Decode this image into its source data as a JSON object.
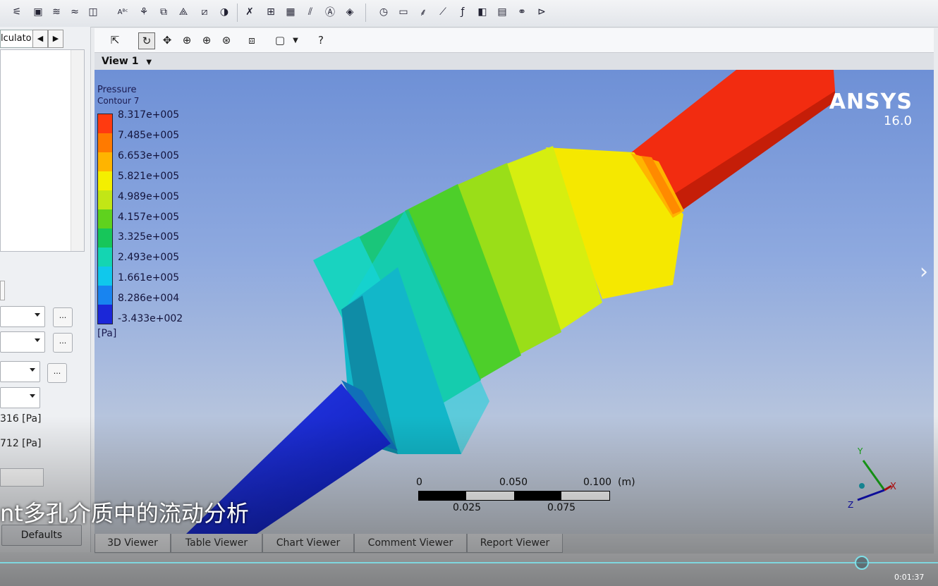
{
  "toolbar": {
    "icons": [
      "workflow-icon",
      "location-icon",
      "vector-icon",
      "streamline-icon",
      "volume-icon",
      "text-icon",
      "probe-icon",
      "coordinate-frame-icon",
      "symmetry-icon",
      "clip-plane-icon",
      "color-map-icon",
      "variable-icon",
      "table-icon",
      "chart-icon",
      "comment-icon",
      "figure-icon",
      "timestep-icon",
      "animation-icon",
      "quick-edit-icon",
      "pointer-icon",
      "function-icon",
      "report-icon",
      "export-icon",
      "mesh-icon",
      "command-icon"
    ]
  },
  "left_panel": {
    "calculator_tab": "lculato",
    "prev_arrow": "◀",
    "next_arrow": "▶",
    "value_1": "316 [Pa]",
    "value_2": "712 [Pa]",
    "dots": "...",
    "defaults_button": "Defaults"
  },
  "viewer": {
    "view_title": "View 1",
    "tool_icons": [
      "select-icon",
      "rotate-icon",
      "pan-icon",
      "zoom-icon",
      "zoom-box-icon",
      "fit-view-icon",
      "orthographic-icon",
      "viewport-layout-icon",
      "help-icon"
    ]
  },
  "legend": {
    "variable": "Pressure",
    "name": "Contour 7",
    "unit": "[Pa]",
    "values": [
      "8.317e+005",
      "7.485e+005",
      "6.653e+005",
      "5.821e+005",
      "4.989e+005",
      "4.157e+005",
      "3.325e+005",
      "2.493e+005",
      "1.661e+005",
      "8.286e+004",
      "-3.433e+002"
    ],
    "colors": [
      "#ff3a10",
      "#ff7a00",
      "#ffb400",
      "#f4ef00",
      "#c2e616",
      "#5fd21e",
      "#17c65a",
      "#14d5b2",
      "#10c8ec",
      "#1884f0",
      "#1b27d8"
    ]
  },
  "logo": {
    "brand": "ANSYS",
    "version": "16.0"
  },
  "scale": {
    "top_labels": [
      "0",
      "0.050",
      "0.100"
    ],
    "unit": "(m)",
    "bottom_labels": [
      "0.025",
      "0.075"
    ]
  },
  "axes": {
    "y": "Y",
    "x": "X",
    "z": "Z"
  },
  "tabs": [
    "3D Viewer",
    "Table Viewer",
    "Chart Viewer",
    "Comment Viewer",
    "Report Viewer"
  ],
  "video": {
    "subtitle": "nt多孔介质中的流动分析",
    "timecode": "0:01:37",
    "progress": 0.917
  }
}
